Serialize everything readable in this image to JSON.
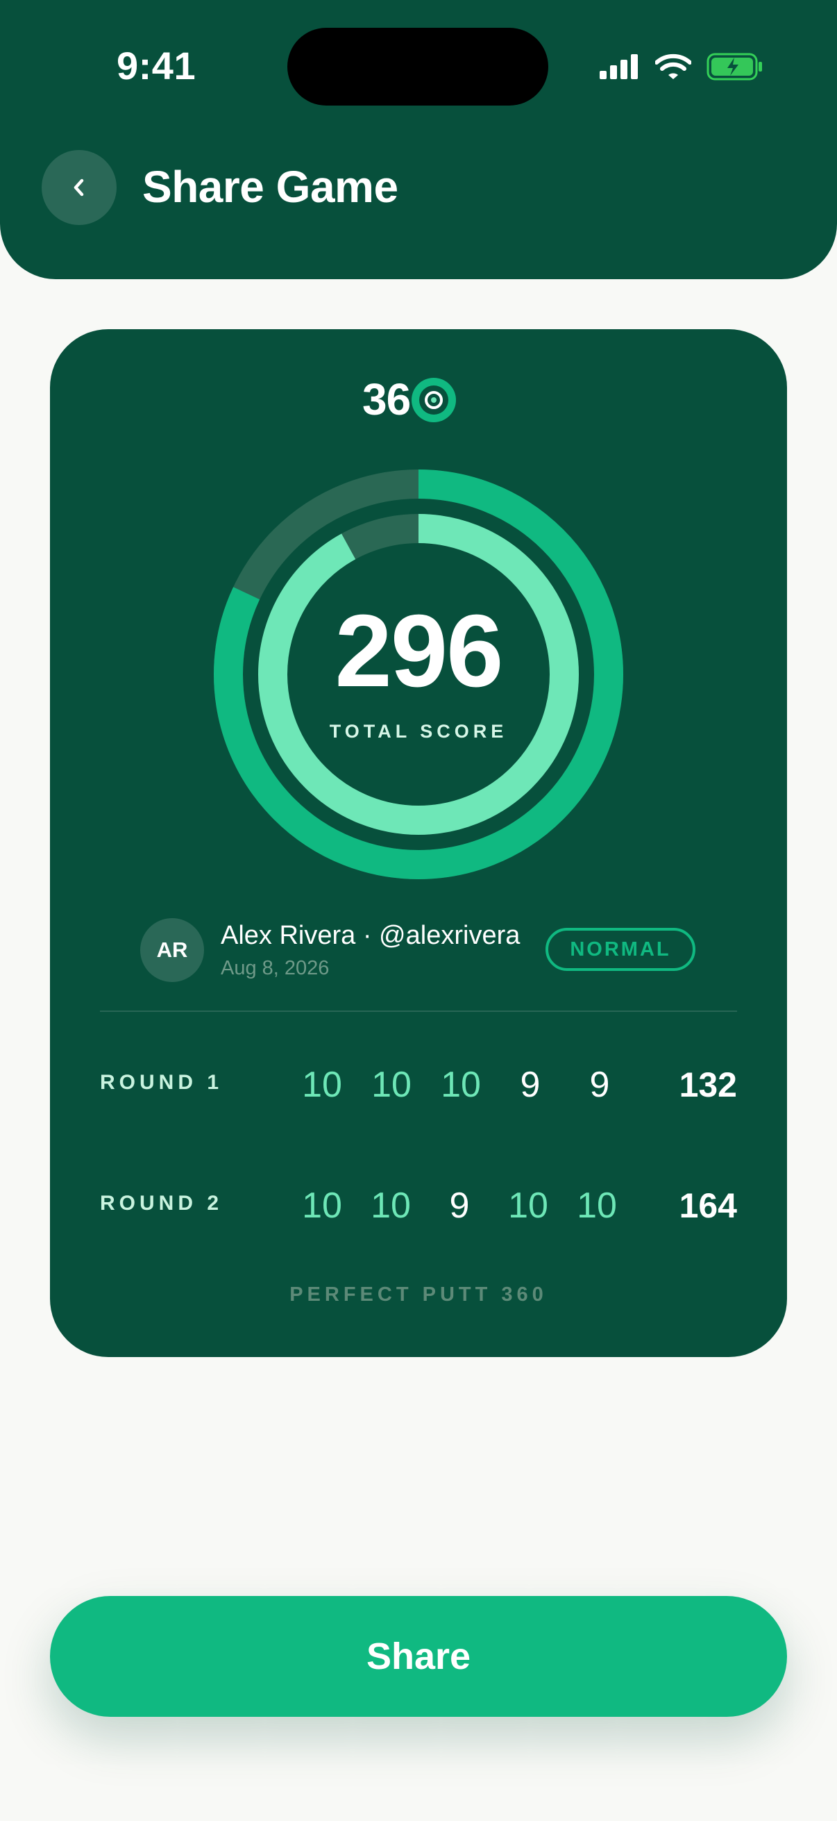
{
  "status_bar": {
    "time": "9:41"
  },
  "header": {
    "title": "Share Game"
  },
  "card": {
    "logo_text": "36",
    "score": "296",
    "score_label": "TOTAL SCORE",
    "rings": {
      "outer_progress": 0.82,
      "inner_progress": 0.92,
      "colors": {
        "outer": "#10b981",
        "inner": "#6ee7b7",
        "track": "#2a6854",
        "background": "#07503c"
      }
    },
    "player": {
      "initials": "AR",
      "name_line": "Alex Rivera · @alexrivera",
      "date": "Aug 8, 2026",
      "difficulty": "NORMAL"
    },
    "rounds": [
      {
        "label": "ROUND 1",
        "holes": [
          "10",
          "10",
          "10",
          "9",
          "9"
        ],
        "total": "132"
      },
      {
        "label": "ROUND 2",
        "holes": [
          "10",
          "10",
          "9",
          "10",
          "10"
        ],
        "total": "164"
      }
    ],
    "footer": "PERFECT PUTT 360"
  },
  "share_button": {
    "label": "Share"
  },
  "colors": {
    "brand_dark": "#07503c",
    "accent": "#10b981",
    "accent_light": "#6ee7b7",
    "page_bg": "#f8f9f6"
  },
  "icons": [
    "signal-icon",
    "wifi-icon",
    "battery-icon",
    "back-chevron-icon",
    "logo-target-icon"
  ]
}
